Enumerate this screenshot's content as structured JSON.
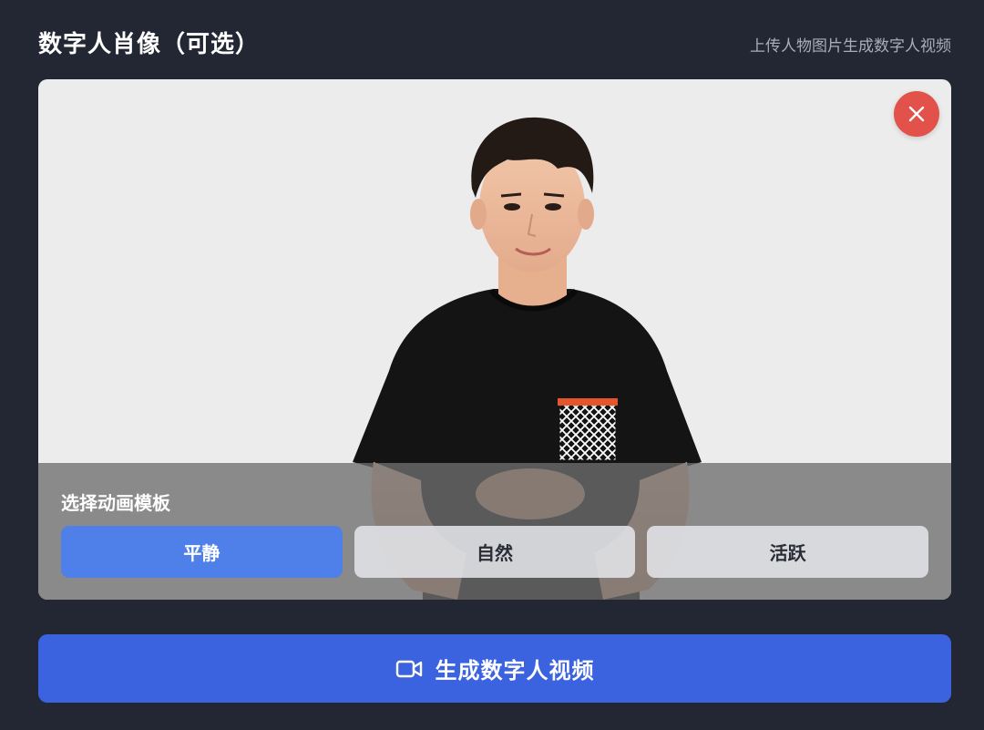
{
  "header": {
    "title": "数字人肖像（可选）",
    "hint": "上传人物图片生成数字人视频"
  },
  "portrait": {
    "close_icon": "close-icon",
    "close_color": "#e2514a"
  },
  "template": {
    "label": "选择动画模板",
    "options": [
      {
        "label": "平静",
        "selected": true
      },
      {
        "label": "自然",
        "selected": false
      },
      {
        "label": "活跃",
        "selected": false
      }
    ],
    "active_color": "#4f7fe8"
  },
  "generate": {
    "label": "生成数字人视频",
    "icon": "video-camera-icon",
    "color": "#3b63e0"
  },
  "colors": {
    "background": "#232733",
    "card_background": "#ececec"
  }
}
